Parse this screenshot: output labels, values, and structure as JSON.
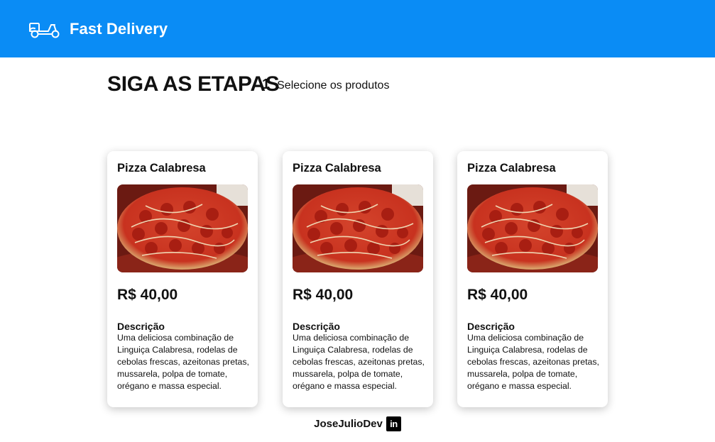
{
  "header": {
    "brand": "Fast Delivery",
    "logo_icon": "scooter-icon",
    "background_color": "#0a8cf5"
  },
  "steps": {
    "title": "SIGA AS ETAPAS",
    "items": [
      {
        "number": "1",
        "label": "Selecione os produtos"
      }
    ]
  },
  "products": [
    {
      "name": "Pizza Calabresa",
      "price": "R$ 40,00",
      "description_label": "Descrição",
      "description": "Uma deliciosa combinação de Linguiça Calabresa, rodelas de cebolas frescas, azeitonas pretas, mussarela, polpa de tomate, orégano e massa especial."
    },
    {
      "name": "Pizza Calabresa",
      "price": "R$ 40,00",
      "description_label": "Descrição",
      "description": "Uma deliciosa combinação de Linguiça Calabresa, rodelas de cebolas frescas, azeitonas pretas, mussarela, polpa de tomate, orégano e massa especial."
    },
    {
      "name": "Pizza Calabresa",
      "price": "R$ 40,00",
      "description_label": "Descrição",
      "description": "Uma deliciosa combinação de Linguiça Calabresa, rodelas de cebolas frescas, azeitonas pretas, mussarela, polpa de tomate, orégano e massa especial."
    }
  ],
  "footer": {
    "author": "JoseJulioDev",
    "social_icon": "linkedin-icon",
    "social_icon_text": "in"
  }
}
